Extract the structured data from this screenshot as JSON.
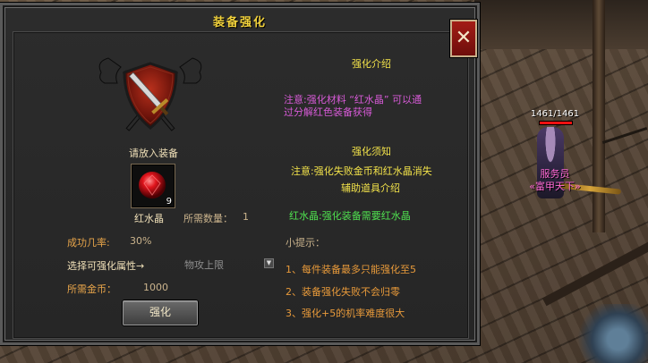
{
  "window": {
    "title": "装备强化",
    "close_icon": "close-icon"
  },
  "left": {
    "place_hint": "请放入装备",
    "item_name": "红水晶",
    "item_count": "9",
    "required_qty_label": "所需数量：",
    "required_qty_value": "1",
    "success_rate_label": "成功几率:",
    "success_rate_value": "30%",
    "attribute_label": "选择可强化属性→",
    "attribute_selected": "物攻上限",
    "gold_label": "所需金币：",
    "gold_value": "1000",
    "strengthen_button": "强化"
  },
  "right": {
    "intro_title": "强化介绍",
    "intro_note_line1": "注意:强化材料 “红水晶” 可以通",
    "intro_note_line2": "过分解红色装备获得",
    "rules_title": "强化须知",
    "rules_line1": "注意:强化失败金币和红水晶消失",
    "rules_line2": "辅助道具介绍",
    "material_note": "红水晶:强化装备需要红水晶",
    "tips_title": "小提示：",
    "tips": [
      "1、每件装备最多只能强化至5",
      "2、装备强化失败不会归零",
      "3、强化+5的机率难度很大"
    ]
  },
  "player": {
    "hp_text": "1461/1461",
    "hp_fraction": 1.0,
    "name_line1": "服务员",
    "name_line2": "«富甲天下»"
  },
  "colors": {
    "title": "#f2d23c",
    "heading": "#f2e24a",
    "note": "#d65ad6",
    "material": "#4fe04f",
    "tips": "#e89a3a",
    "player_name": "#ff6ad5"
  }
}
